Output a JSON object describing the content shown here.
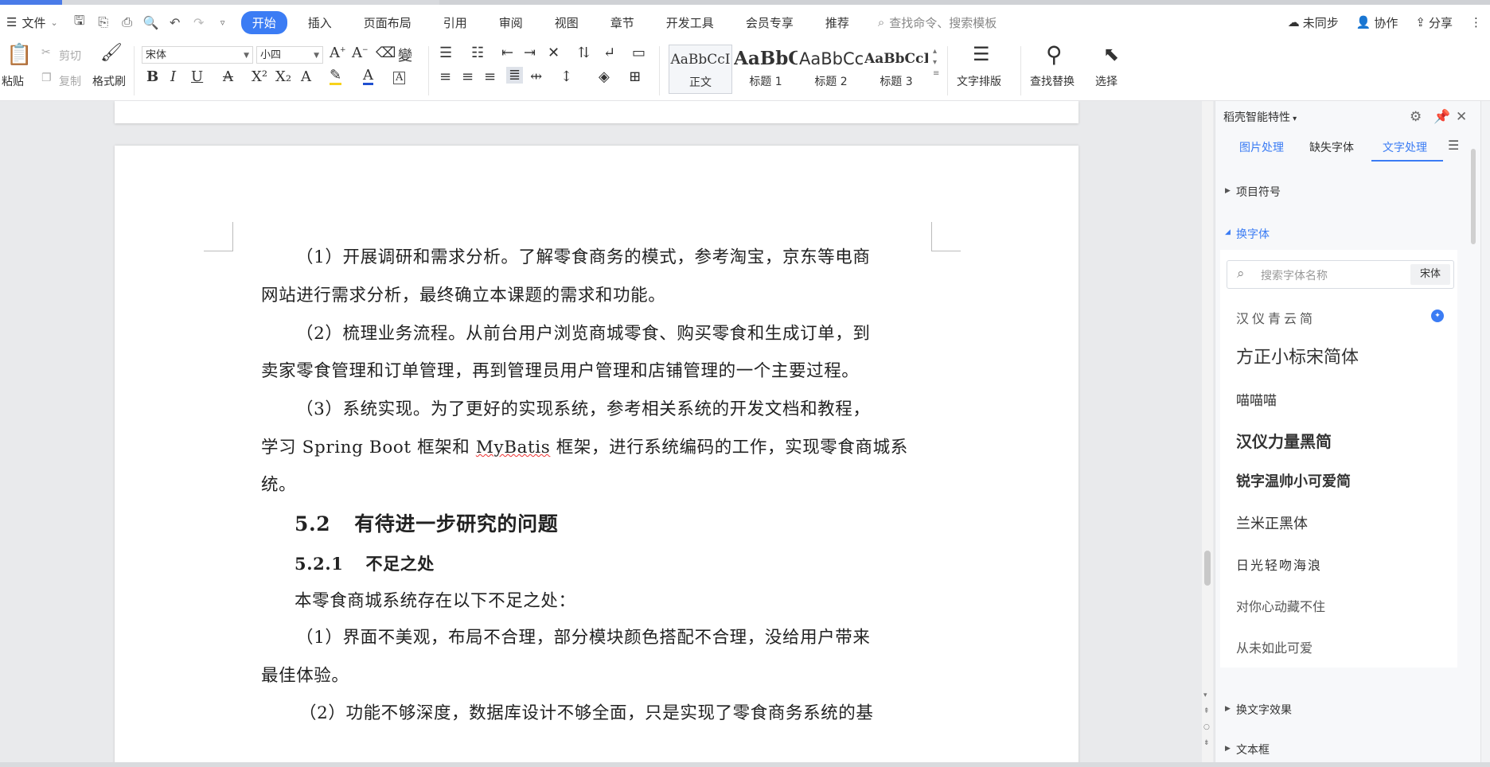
{
  "menu": {
    "file_label": "文件",
    "tabs": [
      "开始",
      "插入",
      "页面布局",
      "引用",
      "审阅",
      "视图",
      "章节",
      "开发工具",
      "会员专享",
      "推荐"
    ],
    "active_tab": "开始",
    "search_placeholder": "查找命令、搜索模板",
    "sync_label": "未同步",
    "collab_label": "协作",
    "share_label": "分享"
  },
  "ribbon": {
    "paste_label": "粘贴",
    "cut_label": "剪切",
    "copy_label": "复制",
    "format_painter_label": "格式刷",
    "font_name": "宋体",
    "font_size": "小四",
    "styles": [
      {
        "preview": "AaBbCcI",
        "label": "正文"
      },
      {
        "preview": "AaBbC",
        "label": "标题 1"
      },
      {
        "preview": "AaBbCc",
        "label": "标题 2"
      },
      {
        "preview": "AaBbCcI",
        "label": "标题 3"
      }
    ],
    "text_layout_label": "文字排版",
    "find_replace_label": "查找替换",
    "select_label": "选择"
  },
  "document": {
    "p1a": "（1）开展调研和需求分析。了解零食商务的模式，参考淘宝，京东等电商",
    "p1b": "网站进行需求分析，最终确立本课题的需求和功能。",
    "p2a": "（2）梳理业务流程。从前台用户浏览商城零食、购买零食和生成订单，到",
    "p2b": "卖家零食管理和订单管理，再到管理员用户管理和店铺管理的一个主要过程。",
    "p3a": "（3）系统实现。为了更好的实现系统，参考相关系统的开发文档和教程，",
    "p3b_pre": "学习 Spring Boot 框架和 ",
    "p3b_mark": "MyBatis",
    "p3b_post": " 框架，进行系统编码的工作，实现零食商城系",
    "p3c": "统。",
    "h2_num": "5.2",
    "h2_text": "有待进一步研究的问题",
    "h3_num": "5.2.1",
    "h3_text": "不足之处",
    "p4": "本零食商城系统存在以下不足之处：",
    "p5a": "（1）界面不美观，布局不合理，部分模块颜色搭配不合理，没给用户带来",
    "p5b": "最佳体验。",
    "p6a": "（2）功能不够深度，数据库设计不够全面，只是实现了零食商务系统的基"
  },
  "panel": {
    "title": "稻壳智能特性",
    "tabs": [
      "图片处理",
      "缺失字体",
      "文字处理"
    ],
    "active_tab": "文字处理",
    "section_bullets": "项目符号",
    "section_change_font": "换字体",
    "font_search_placeholder": "搜索字体名称",
    "current_font": "宋体",
    "fonts": [
      "汉仪青云简",
      "方正小标宋简体",
      "喵喵喵",
      "汉仪力量黑简",
      "锐字温帅小可爱简",
      "兰米正黑体",
      "日光轻吻海浪",
      "对你心动藏不住",
      "从未如此可爱"
    ],
    "section_text_effect": "换文字效果",
    "section_textbox": "文本框"
  },
  "colors": {
    "accent": "#3b7cf4"
  }
}
